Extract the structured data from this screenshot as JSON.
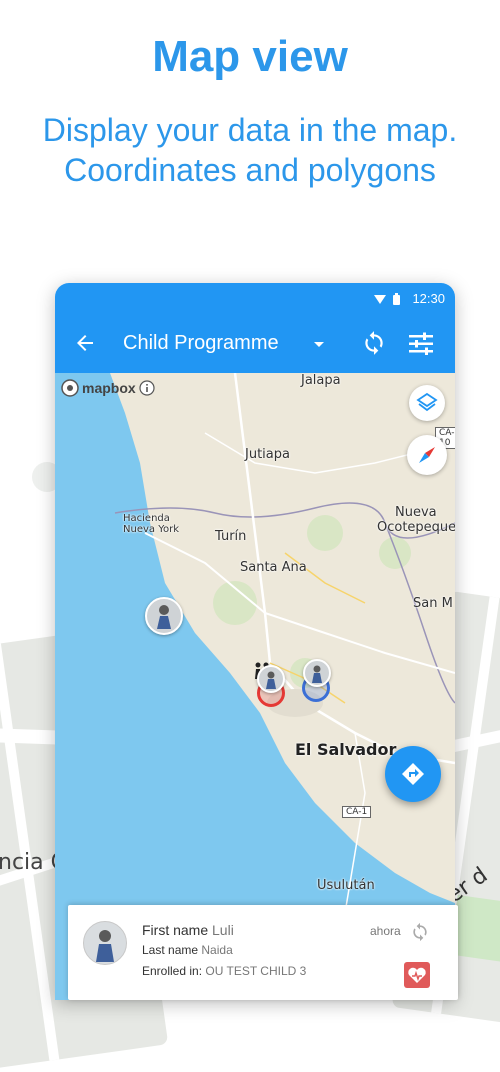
{
  "promo": {
    "title": "Map view",
    "subtitle_line1": "Display your data in the map.",
    "subtitle_line2": "Coordinates and polygons"
  },
  "background": {
    "label_left": "ncia C",
    "label_right": "rrer d"
  },
  "status_bar": {
    "time": "12:30"
  },
  "app_bar": {
    "title": "Child Programme"
  },
  "map": {
    "attribution": "mapbox",
    "labels": {
      "jalapa": "Jalapa",
      "jutiapa": "Jutiapa",
      "hacienda_line1": "Hacienda",
      "hacienda_line2": "Nueva York",
      "turin": "Turín",
      "santa_ana": "Santa Ana",
      "nueva_line1": "Nueva",
      "nueva_line2": "Ocotepeque",
      "san_m": "San M",
      "el_salvador": "El Salvador",
      "usulutan": "Usulután"
    },
    "shields": {
      "ca10": "CA-10",
      "ca1": "CA-1"
    }
  },
  "card": {
    "first_name_label": "First name",
    "first_name_value": "Luli",
    "last_name_label": "Last name",
    "last_name_value": "Naida",
    "enrolled_label": "Enrolled in:",
    "enrolled_value": "OU TEST CHILD 3",
    "time": "ahora"
  },
  "colors": {
    "accent": "#2196f3",
    "promo_text": "#2c97ea",
    "sea": "#7ec8ef",
    "land": "#ede8da"
  },
  "icons": [
    "back-arrow-icon",
    "dropdown-icon",
    "sync-icon",
    "filter-icon",
    "layers-icon",
    "compass-icon",
    "directions-icon",
    "person-avatar-icon",
    "heart-badge-icon",
    "info-icon",
    "wifi-icon",
    "battery-icon"
  ]
}
